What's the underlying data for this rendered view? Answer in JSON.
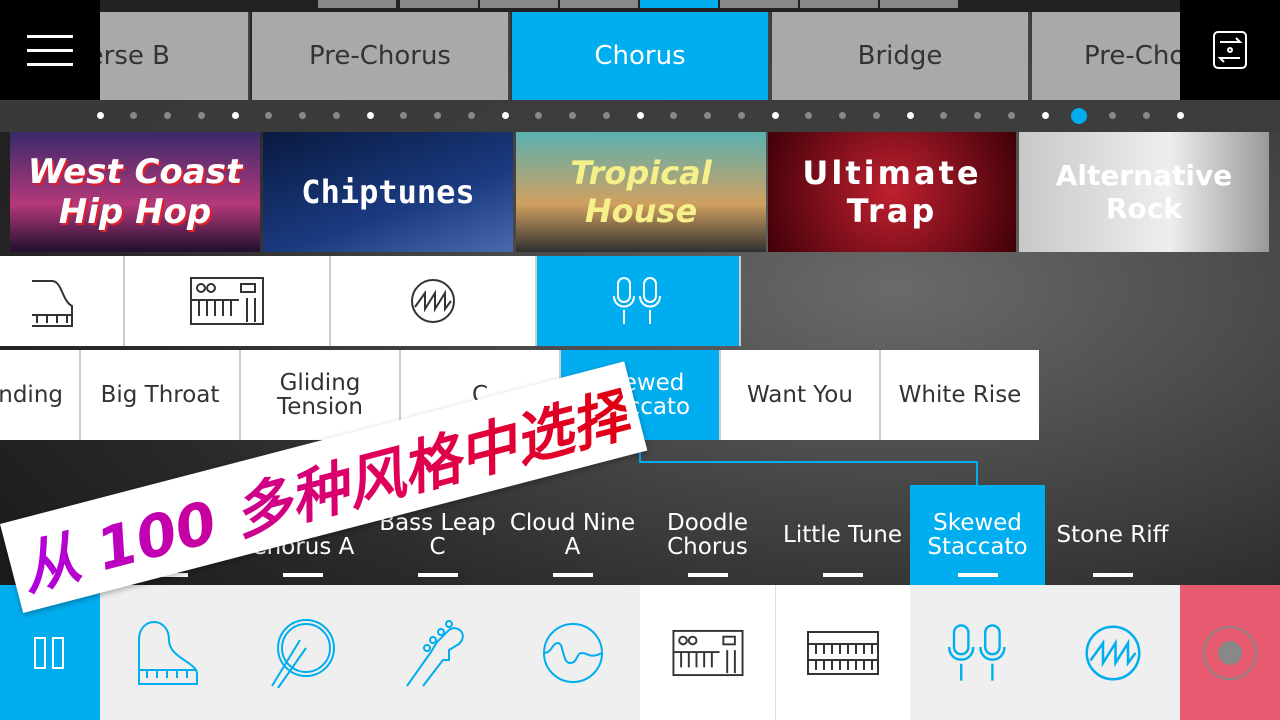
{
  "sections": {
    "tabs": [
      {
        "label": "Verse B"
      },
      {
        "label": "Pre-Chorus"
      },
      {
        "label": "Chorus",
        "active": true
      },
      {
        "label": "Bridge"
      },
      {
        "label": "Pre-Chorus"
      }
    ]
  },
  "pager": {
    "count": 33,
    "active_index": 29
  },
  "genres": [
    {
      "label": "West Coast Hip Hop"
    },
    {
      "label": "Chiptunes"
    },
    {
      "label": "Tropical House"
    },
    {
      "label": "Ultimate Trap"
    },
    {
      "label": "Alternative Rock"
    }
  ],
  "instruments": [
    {
      "icon": "piano-icon"
    },
    {
      "icon": "synth-icon"
    },
    {
      "icon": "sawtooth-wave-icon"
    },
    {
      "icon": "microphones-icon",
      "active": true
    }
  ],
  "patterns": [
    {
      "label": "nding"
    },
    {
      "label": "Big Throat"
    },
    {
      "label": "Gliding Tension"
    },
    {
      "label": "C"
    },
    {
      "label": "Skewed Staccato",
      "active": true
    },
    {
      "label": "Want You"
    },
    {
      "label": "White Rise"
    }
  ],
  "variations": [
    {
      "label": ""
    },
    {
      "label": "Up The Chorus A"
    },
    {
      "label": "Bass Leap C"
    },
    {
      "label": "Cloud Nine  A"
    },
    {
      "label": "Doodle Chorus"
    },
    {
      "label": "Little Tune"
    },
    {
      "label": "Skewed Staccato",
      "active": true
    },
    {
      "label": "Stone Riff"
    }
  ],
  "toolbar": {
    "items": [
      "piano-icon",
      "drum-icon",
      "bass-guitar-icon",
      "wave-icon",
      "synth-icon",
      "keyboard-icon",
      "microphones-icon",
      "sawtooth-wave-icon"
    ],
    "pause": "pause-icon",
    "record": "record-icon"
  },
  "banner": {
    "text": "从 100 多种风格中选择"
  },
  "colors": {
    "accent": "#00adee",
    "record": "#e85a70"
  }
}
